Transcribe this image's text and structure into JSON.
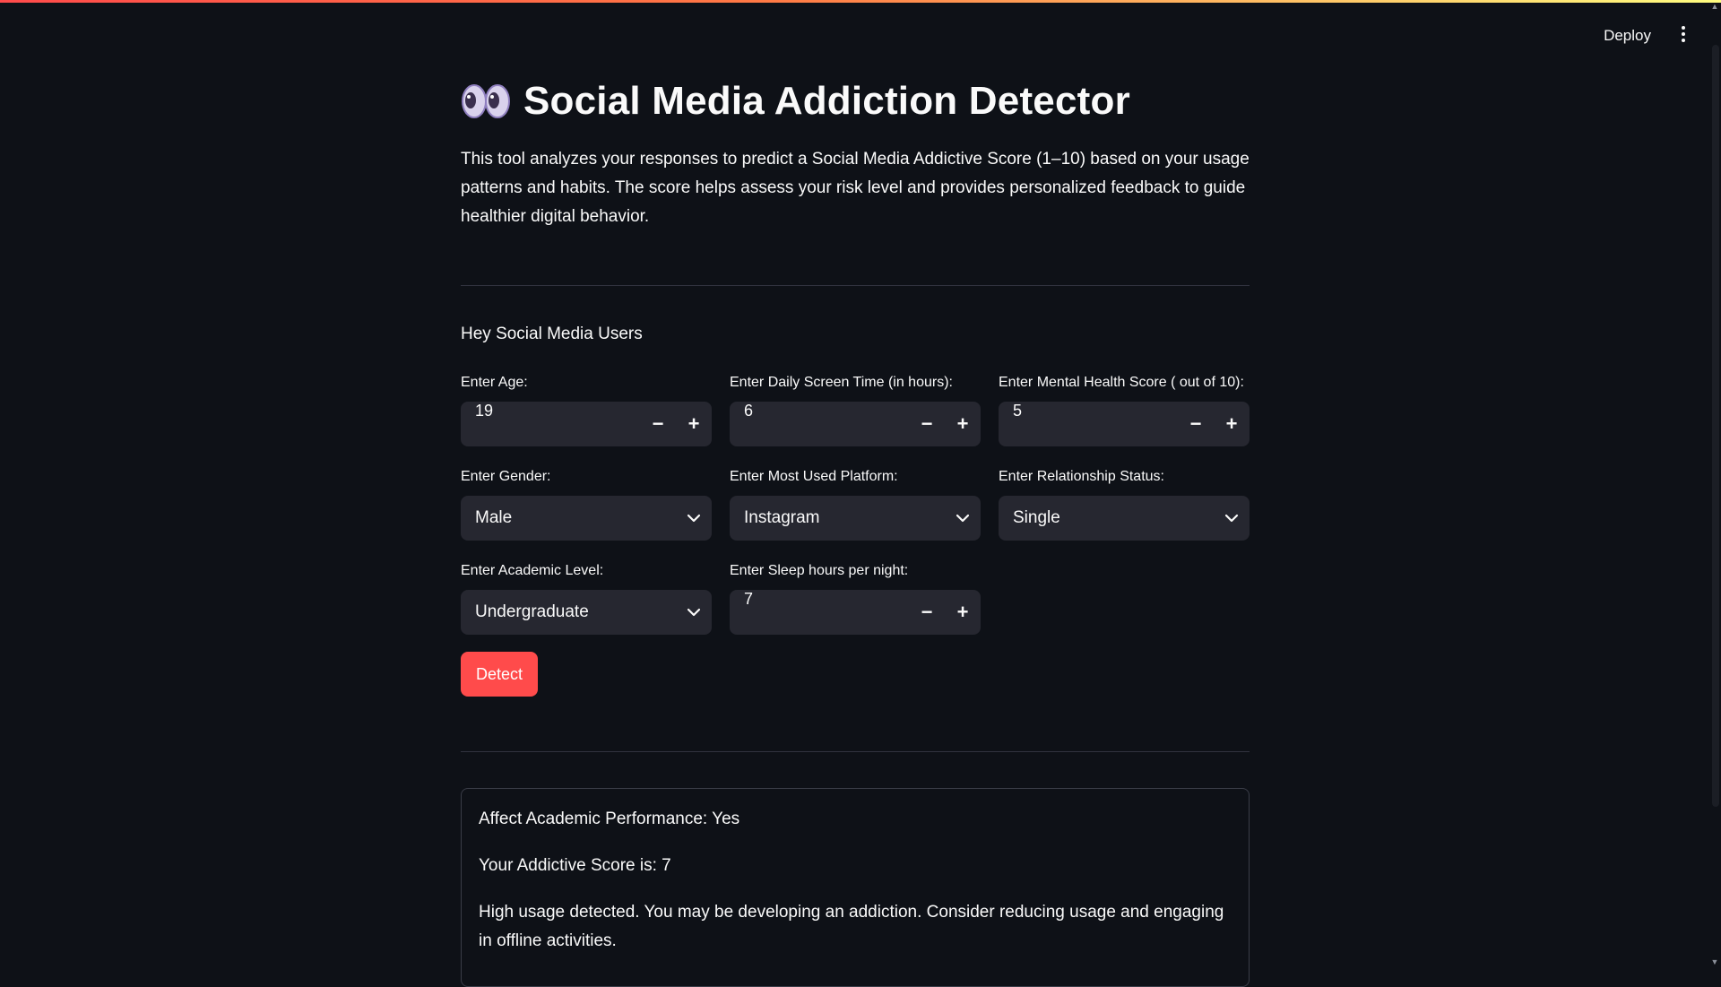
{
  "header": {
    "deploy_label": "Deploy",
    "menu_icon": "vertical-dots-icon"
  },
  "app": {
    "title_icon": "eyes-emoji-icon",
    "title": "Social Media Addiction Detector",
    "intro": "This tool analyzes your responses to predict a Social Media Addictive Score (1–10) based on your usage patterns and habits. The score helps assess your risk level and provides personalized feedback to guide healthier digital behavior."
  },
  "form": {
    "heading": "Hey Social Media Users",
    "age": {
      "label": "Enter Age:",
      "value": "19"
    },
    "screen_time": {
      "label": "Enter Daily Screen Time (in hours):",
      "value": "6"
    },
    "mental_health": {
      "label": "Enter Mental Health Score ( out of 10):",
      "value": "5"
    },
    "gender": {
      "label": "Enter Gender:",
      "value": "Male"
    },
    "platform": {
      "label": "Enter Most Used Platform:",
      "value": "Instagram"
    },
    "relationship": {
      "label": "Enter Relationship Status:",
      "value": "Single"
    },
    "academic": {
      "label": "Enter Academic Level:",
      "value": "Undergraduate"
    },
    "sleep": {
      "label": "Enter Sleep hours per night:",
      "value": "7"
    },
    "minus": "−",
    "plus": "+",
    "detect_label": "Detect"
  },
  "result": {
    "academic_effect": "Affect Academic Performance: Yes",
    "score": "Your Addictive Score is: 7",
    "feedback": "High usage detected. You may be developing an addiction. Consider reducing usage and engaging in offline activities."
  },
  "colors": {
    "background": "#0e1117",
    "input_bg": "#262730",
    "primary": "#ff4b4b",
    "text": "#fafafa"
  }
}
